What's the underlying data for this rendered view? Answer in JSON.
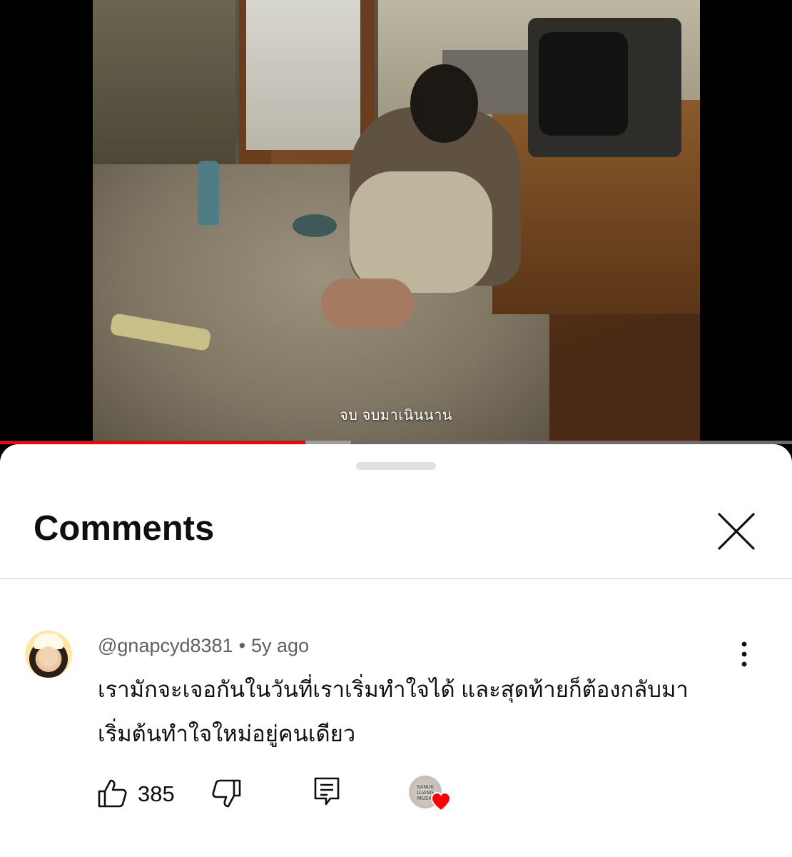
{
  "video": {
    "subtitle": "จบ จบมาเนินนาน",
    "progress_played": 0.386,
    "progress_buffered": 0.443,
    "accent_color": "#ff0000"
  },
  "comments_panel": {
    "title": "Comments",
    "close_icon": "close-icon"
  },
  "comment": {
    "author": "@gnapcyd8381",
    "separator": "•",
    "time": "5y ago",
    "text_line1": "เรามักจะเจอกันในวันที่เราเริ่มทำใจได้ และสุดท้ายก็ต้องกลับมา",
    "text_line2": "เริ่มต้นทำใจใหม่อยู่คนเดียว",
    "like_count": "385",
    "creator_heart": true,
    "creator_avatar_text": "SANUK LUANG MUSIC",
    "heart_color": "#ff0000"
  }
}
